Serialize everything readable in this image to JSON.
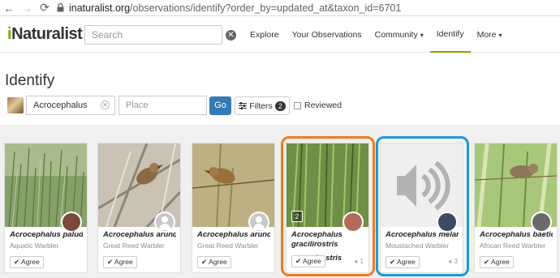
{
  "browser": {
    "back_icon": "←",
    "forward_icon": "→",
    "reload_icon": "⟳",
    "lock_icon": "🔒",
    "url_host": "inaturalist.org",
    "url_path": "/observations/identify?order_by=updated_at&taxon_id=6701"
  },
  "header": {
    "logo_i": "i",
    "logo_rest": "Naturalist",
    "search_placeholder": "Search",
    "nav": [
      {
        "label": "Explore"
      },
      {
        "label": "Your Observations"
      },
      {
        "label": "Community",
        "caret": "▾"
      },
      {
        "label": "Identify"
      },
      {
        "label": "More",
        "caret": "▾"
      }
    ]
  },
  "page": {
    "title": "Identify"
  },
  "filters": {
    "taxon_value": "Acrocephalus",
    "place_placeholder": "Place",
    "go_label": "Go",
    "filters_label": "Filters",
    "filters_count": "2",
    "reviewed_label": "Reviewed"
  },
  "cards": [
    {
      "name": "Acrocephalus paludicola",
      "common": "Aquatic Warbler",
      "agree": "Agree",
      "avatar": "photo"
    },
    {
      "name": "Acrocephalus arundinaceus",
      "common": "Great Reed Warbler",
      "agree": "Agree",
      "avatar": "default"
    },
    {
      "name": "Acrocephalus arundinaceus",
      "common": "Great Reed Warbler",
      "agree": "Agree",
      "avatar": "default"
    },
    {
      "name": "Acrocephalus gracilirostris",
      "overflow_text": "irostris",
      "agree": "Agree",
      "photo_count": "2",
      "comments": "1",
      "avatar": "photo"
    },
    {
      "name": "Acrocephalus melanopogon",
      "common": "Moustached Warbler",
      "agree": "Agree",
      "comments": "3",
      "avatar": "photo"
    },
    {
      "name": "Acrocephalus baeticatus",
      "common": "African Reed Warbler",
      "agree": "Agree",
      "avatar": "photo"
    }
  ],
  "colors": {
    "brand_green": "#74ac00",
    "go_blue": "#337ab7",
    "highlight_orange": "#f07c1c",
    "highlight_blue": "#1b9ad6"
  },
  "icons": {
    "agree_check": "✔",
    "comment": "💬",
    "clear": "✕"
  }
}
